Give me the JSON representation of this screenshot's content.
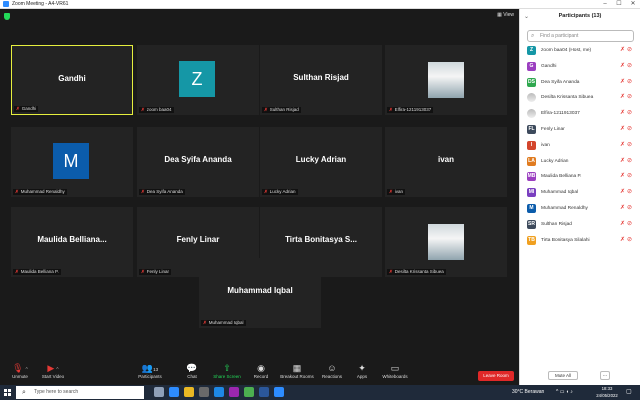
{
  "window": {
    "title": "Zoom Meeting - A4-VR61"
  },
  "header": {
    "view_label": "View"
  },
  "tiles": [
    {
      "big": "Gandhi",
      "label": "Gandhi",
      "active": true
    },
    {
      "avatar": "Z",
      "avatar_color": "#1597a6",
      "label": "zoom baa04"
    },
    {
      "big": "Sulthan Risjad",
      "label": "Sulthan Risjad"
    },
    {
      "photo": true,
      "label": "Elfira-1211913037"
    },
    {
      "avatar": "M",
      "avatar_color": "#0b5cab",
      "label": "Muhammad Renaldhy"
    },
    {
      "big": "Dea Syifa Ananda",
      "label": "Dea Syifa Ananda"
    },
    {
      "big": "Lucky Adrian",
      "label": "Lucky Adrian"
    },
    {
      "big": "ivan",
      "label": "ivan"
    },
    {
      "big": "Maulida Belliana...",
      "label": "Maulida Belliana P."
    },
    {
      "big": "Fenly Linar",
      "label": "Fenly Linar"
    },
    {
      "big": "Tirta Bonitasya S...",
      "label": "Tirta Bonitasya Silalahi"
    },
    {
      "photo": true,
      "label": "Desilta Krissanta Sibuea"
    },
    {
      "big": "Muhammad Iqbal",
      "label": "Muhammad Iqbal"
    }
  ],
  "toolbar": {
    "unmute": "Unmute",
    "start_video": "Start Video",
    "participants": "Participants",
    "participants_count": "13",
    "chat": "Chat",
    "share_screen": "Share Screen",
    "record": "Record",
    "breakout": "Breakout Rooms",
    "reactions": "Reactions",
    "apps": "Apps",
    "whiteboards": "Whiteboards",
    "leave": "Leave Room"
  },
  "panel": {
    "title": "Participants (13)",
    "search_placeholder": "Find a participant",
    "participants": [
      {
        "initials": "Z",
        "color": "#1597a6",
        "name": "zoom baa04 (Host, me)"
      },
      {
        "initials": "G",
        "color": "#9b3fc0",
        "name": "Gandhi"
      },
      {
        "initials": "DS",
        "color": "#2fa84f",
        "name": "Dea Syifa Ananda"
      },
      {
        "photo": true,
        "name": "Desilta Krissanta Sibuea"
      },
      {
        "photo": true,
        "name": "Elfira-1211913037"
      },
      {
        "initials": "FL",
        "color": "#3d4a5c",
        "name": "Fenly Linar"
      },
      {
        "initials": "I",
        "color": "#d3452c",
        "name": "ivan"
      },
      {
        "initials": "LA",
        "color": "#e07b1f",
        "name": "Lucky Adrian"
      },
      {
        "initials": "MB",
        "color": "#9b3fc0",
        "name": "Maulida Belliana P."
      },
      {
        "initials": "MI",
        "color": "#7a3fc0",
        "name": "Muhammad Iqbal"
      },
      {
        "initials": "M",
        "color": "#0b5cab",
        "name": "Muhammad Renaldhy"
      },
      {
        "initials": "SR",
        "color": "#3d4a5c",
        "name": "Sulthan Risjad"
      },
      {
        "initials": "TB",
        "color": "#f0a020",
        "name": "Tirta Bonitasya Silalahi"
      }
    ],
    "mute_all": "Mute All",
    "more": "..."
  },
  "taskbar": {
    "search_placeholder": "Type here to search",
    "weather": "30°C  Berawan",
    "time": "18:33",
    "date": "24/05/2022"
  }
}
